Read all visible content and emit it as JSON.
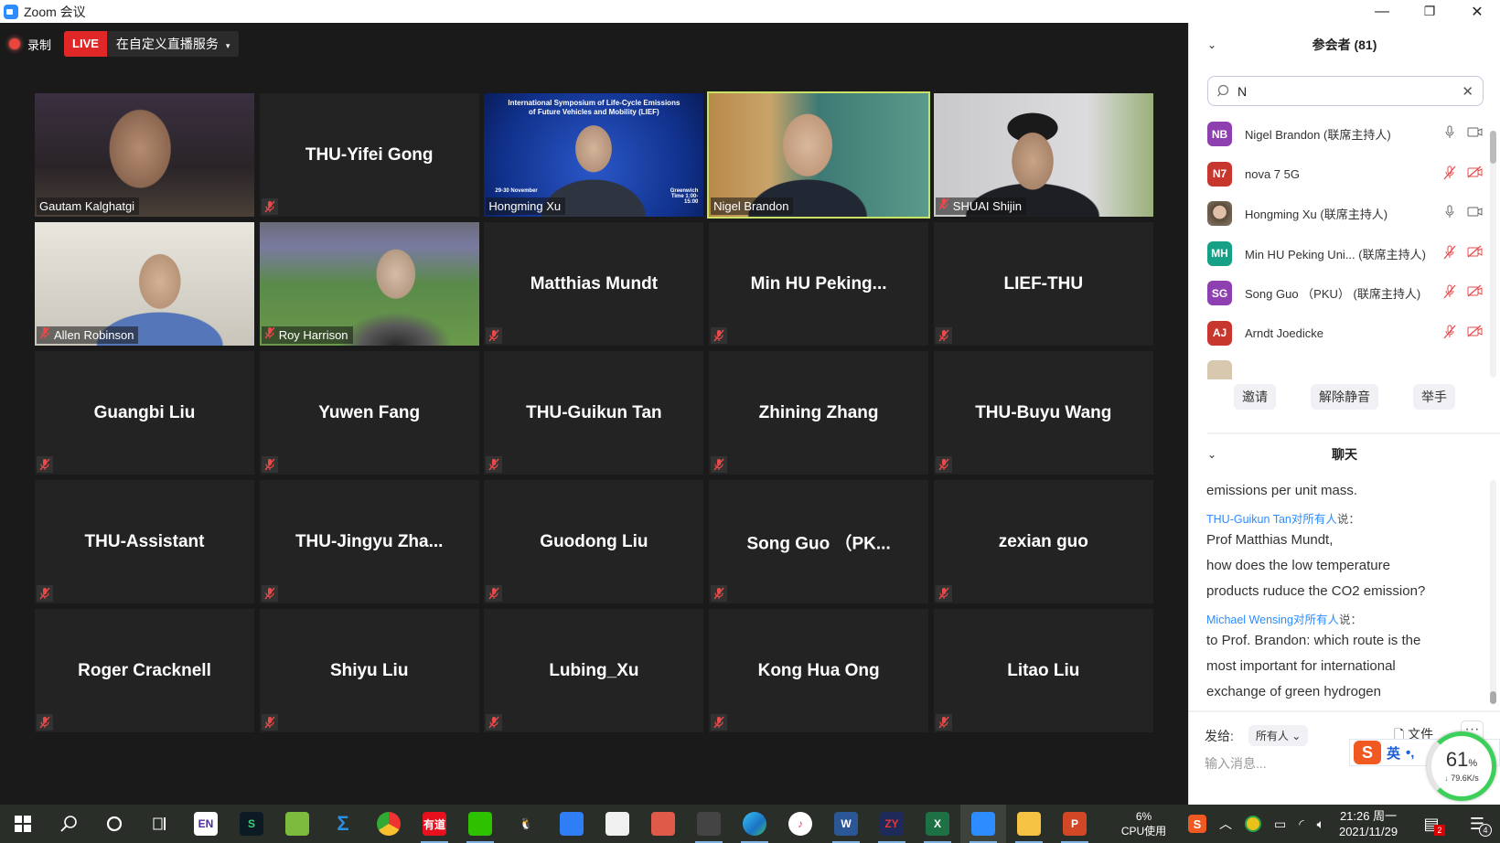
{
  "window": {
    "title": "Zoom 会议",
    "minimize_icon": "minimize-icon",
    "restore_icon": "restore-icon",
    "close_icon": "close-icon"
  },
  "recording": {
    "label": "录制",
    "live_badge": "LIVE",
    "live_service": "在自定义直播服务",
    "live_service_caret": "▾"
  },
  "tiles": [
    {
      "name": "Gautam Kalghatgi",
      "video": true,
      "muted": false,
      "bg": "gautam"
    },
    {
      "name": "THU-Yifei Gong",
      "video": false,
      "muted": true
    },
    {
      "name": "Hongming Xu",
      "video": true,
      "muted": false,
      "bg": "hongming",
      "slide_title": "International Symposium of Life-Cycle Emissions of Future Vehicles and Mobility (LIEF)",
      "slide_dates": "29-30 November",
      "slide_time": "Greenwich Time 1:00-15:00"
    },
    {
      "name": "Nigel Brandon",
      "video": true,
      "muted": false,
      "active_speaker": true,
      "bg": "nigel"
    },
    {
      "name": "SHUAI Shijin",
      "video": true,
      "muted": true,
      "bg": "shuai"
    },
    {
      "name": "Allen Robinson",
      "video": true,
      "muted": true,
      "bg": "allen"
    },
    {
      "name": "Roy Harrison",
      "video": true,
      "muted": true,
      "bg": "roy"
    },
    {
      "name": "Matthias Mundt",
      "video": false,
      "muted": true
    },
    {
      "name": "Min HU Peking...",
      "video": false,
      "muted": true
    },
    {
      "name": "LIEF-THU",
      "video": false,
      "muted": true
    },
    {
      "name": "Guangbi Liu",
      "video": false,
      "muted": true
    },
    {
      "name": "Yuwen Fang",
      "video": false,
      "muted": true
    },
    {
      "name": "THU-Guikun Tan",
      "video": false,
      "muted": true
    },
    {
      "name": "Zhining Zhang",
      "video": false,
      "muted": true
    },
    {
      "name": "THU-Buyu Wang",
      "video": false,
      "muted": true
    },
    {
      "name": "THU-Assistant",
      "video": false,
      "muted": true
    },
    {
      "name": "THU-Jingyu  Zha...",
      "video": false,
      "muted": true
    },
    {
      "name": "Guodong Liu",
      "video": false,
      "muted": true
    },
    {
      "name": "Song Guo  （PK...",
      "video": false,
      "muted": true
    },
    {
      "name": "zexian guo",
      "video": false,
      "muted": true
    },
    {
      "name": "Roger Cracknell",
      "video": false,
      "muted": true
    },
    {
      "name": "Shiyu Liu",
      "video": false,
      "muted": true
    },
    {
      "name": "Lubing_Xu",
      "video": false,
      "muted": true
    },
    {
      "name": "Kong Hua Ong",
      "video": false,
      "muted": true
    },
    {
      "name": "Litao Liu",
      "video": false,
      "muted": true
    }
  ],
  "participants_panel": {
    "title": "参会者 (81)",
    "search_value": "N",
    "items": [
      {
        "initials": "NB",
        "color": "#8e3fb0",
        "name": "Nigel Brandon (联席主持人)",
        "mic_muted": false,
        "video_off": false
      },
      {
        "initials": "N7",
        "color": "#c8372d",
        "name": "nova 7 5G",
        "mic_muted": true,
        "video_off": true
      },
      {
        "initials": "",
        "photo": true,
        "color": "#8a6a50",
        "name": "Hongming Xu (联席主持人)",
        "mic_muted": false,
        "video_off": false
      },
      {
        "initials": "MH",
        "color": "#16a085",
        "name": "Min HU Peking Uni... (联席主持人)",
        "mic_muted": true,
        "video_off": true
      },
      {
        "initials": "SG",
        "color": "#8e3fb0",
        "name": "Song Guo （PKU） (联席主持人)",
        "mic_muted": true,
        "video_off": true
      },
      {
        "initials": "AJ",
        "color": "#c8372d",
        "name": "Arndt Joedicke",
        "mic_muted": true,
        "video_off": true
      }
    ],
    "buttons": {
      "invite": "邀请",
      "unmute": "解除静音",
      "raise_hand": "举手"
    }
  },
  "chat_panel": {
    "title": "聊天",
    "messages": [
      {
        "sender": "",
        "lines": [
          "emissions per unit mass."
        ]
      },
      {
        "sender": "THU-Guikun Tan",
        "to": "对",
        "recipient": "所有人",
        "said": "说：",
        "lines": [
          "Prof Matthias Mundt,",
          "how does the low temperature",
          "products ruduce the CO2 emission?"
        ]
      },
      {
        "sender": "Michael Wensing",
        "to": "对",
        "recipient": "所有人",
        "said": "说：",
        "lines": [
          "to Prof. Brandon: which route is the",
          "most important for international",
          "exchange of green hydrogen"
        ]
      }
    ],
    "send_to_label": "发给:",
    "send_to_value": "所有人",
    "file_label": "文件",
    "more_label": "···",
    "input_placeholder": "输入消息..."
  },
  "ime": {
    "lang": "英",
    "punct": "•,"
  },
  "network_gauge": {
    "percent": "61",
    "percent_sign": "%",
    "speed": "79.6K/s"
  },
  "taskbar": {
    "apps": [
      {
        "name": "start",
        "label": ""
      },
      {
        "name": "search",
        "label": ""
      },
      {
        "name": "cortana",
        "label": ""
      },
      {
        "name": "task-view",
        "label": ""
      },
      {
        "name": "endnote",
        "label": "EN"
      },
      {
        "name": "app-s",
        "label": "S"
      },
      {
        "name": "notepad-plus",
        "label": ""
      },
      {
        "name": "mathtype",
        "label": "Σ"
      },
      {
        "name": "chrome",
        "label": ""
      },
      {
        "name": "youdao",
        "label": "有道"
      },
      {
        "name": "wechat",
        "label": ""
      },
      {
        "name": "qq",
        "label": ""
      },
      {
        "name": "feishu",
        "label": ""
      },
      {
        "name": "foxit",
        "label": ""
      },
      {
        "name": "origin",
        "label": ""
      },
      {
        "name": "remote-desktop",
        "label": ""
      },
      {
        "name": "edge",
        "label": ""
      },
      {
        "name": "itunes",
        "label": "♪"
      },
      {
        "name": "word",
        "label": "W"
      },
      {
        "name": "zy",
        "label": "ZY"
      },
      {
        "name": "excel",
        "label": "X"
      },
      {
        "name": "zoom",
        "label": ""
      },
      {
        "name": "file-explorer",
        "label": ""
      },
      {
        "name": "powerpoint",
        "label": "P"
      }
    ],
    "cpu_percent": "6%",
    "cpu_label": "CPU使用",
    "time": "21:26 周一",
    "date": "2021/11/29",
    "notification_badge": "2",
    "action_center_badge": "4"
  }
}
